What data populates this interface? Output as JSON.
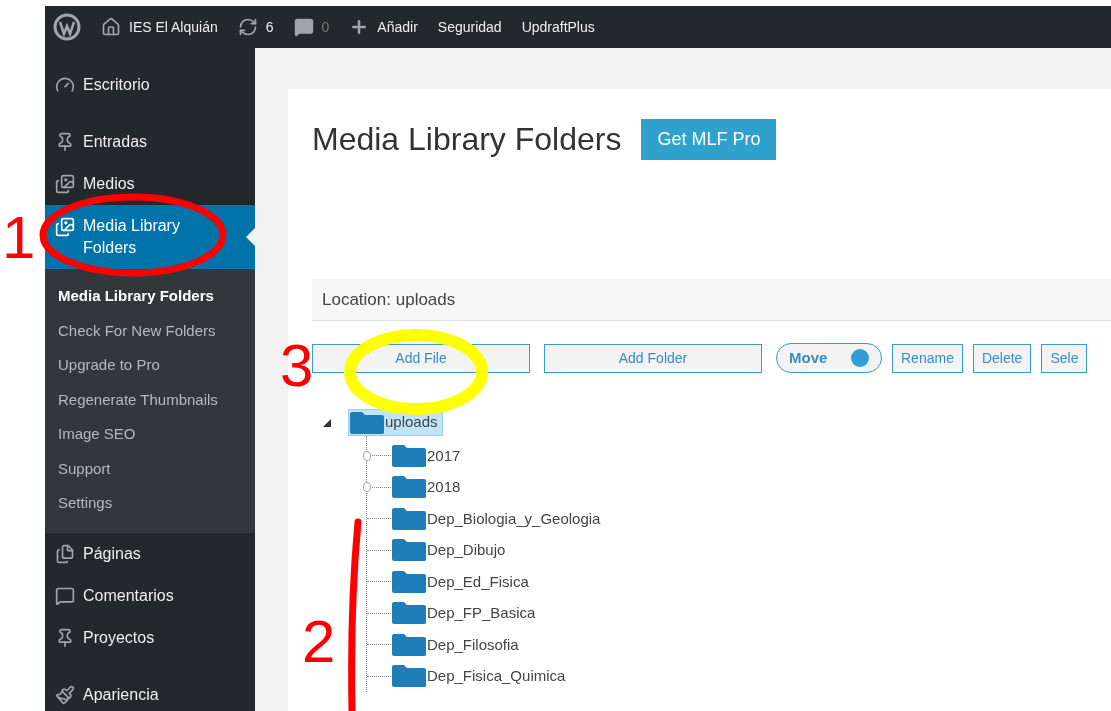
{
  "admin_bar": {
    "site": "IES El Alquián",
    "updates": "6",
    "comments": "0",
    "items": [
      "Añadir",
      "Seguridad",
      "UpdraftPlus"
    ]
  },
  "sidebar": {
    "items": [
      {
        "label": "Escritorio",
        "selected": false
      },
      {
        "label": "Entradas",
        "selected": false
      },
      {
        "label": "Medios",
        "selected": false
      },
      {
        "label": "Media Library Folders",
        "selected": true,
        "submenu": [
          {
            "label": "Media Library Folders",
            "selected": true
          },
          {
            "label": "Check For New Folders",
            "selected": false
          },
          {
            "label": "Upgrade to Pro",
            "selected": false
          },
          {
            "label": "Regenerate Thumbnails",
            "selected": false
          },
          {
            "label": "Image SEO",
            "selected": false
          },
          {
            "label": "Support",
            "selected": false
          },
          {
            "label": "Settings",
            "selected": false
          }
        ]
      },
      {
        "label": "Páginas",
        "selected": false
      },
      {
        "label": "Comentarios",
        "selected": false
      },
      {
        "label": "Proyectos",
        "selected": false
      },
      {
        "label": "Apariencia",
        "selected": false
      }
    ]
  },
  "page": {
    "title": "Media Library Folders",
    "pro_button": "Get MLF Pro",
    "location": "Location: uploads",
    "toolbar": [
      {
        "kind": "button",
        "label": "Add File"
      },
      {
        "kind": "button",
        "label": "Add Folder"
      },
      {
        "kind": "toggle",
        "label": "Move",
        "on": true
      },
      {
        "kind": "small",
        "label": "Rename"
      },
      {
        "kind": "small",
        "label": "Delete"
      },
      {
        "kind": "small",
        "label": "Sele"
      }
    ],
    "tree": {
      "name": "uploads",
      "selected": true,
      "expanded": true,
      "children": [
        {
          "name": "2017",
          "expandable": true
        },
        {
          "name": "2018",
          "expandable": true
        },
        {
          "name": "Dep_Biologia_y_Geologia",
          "expandable": false
        },
        {
          "name": "Dep_Dibujo",
          "expandable": false
        },
        {
          "name": "Dep_Ed_Fisica",
          "expandable": false
        },
        {
          "name": "Dep_FP_Basica",
          "expandable": false
        },
        {
          "name": "Dep_Filosofia",
          "expandable": false
        },
        {
          "name": "Dep_Fisica_Quimica",
          "expandable": false
        }
      ]
    }
  },
  "annotations": [
    "1",
    "2",
    "3"
  ]
}
